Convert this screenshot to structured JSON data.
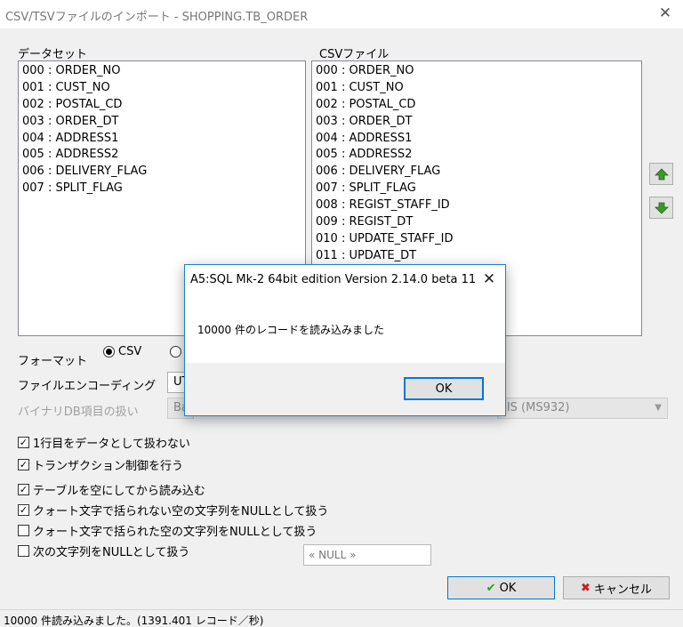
{
  "window": {
    "title": "CSV/TSVファイルのインポート - SHOPPING.TB_ORDER",
    "close_glyph": "✕"
  },
  "dataset": {
    "label": "データセット",
    "items": [
      "000 : ORDER_NO",
      "001 : CUST_NO",
      "002 : POSTAL_CD",
      "003 : ORDER_DT",
      "004 : ADDRESS1",
      "005 : ADDRESS2",
      "006 : DELIVERY_FLAG",
      "007 : SPLIT_FLAG"
    ]
  },
  "csvfile": {
    "label": "CSVファイル",
    "items": [
      "000 : ORDER_NO",
      "001 : CUST_NO",
      "002 : POSTAL_CD",
      "003 : ORDER_DT",
      "004 : ADDRESS1",
      "005 : ADDRESS2",
      "006 : DELIVERY_FLAG",
      "007 : SPLIT_FLAG",
      "008 : REGIST_STAFF_ID",
      "009 : REGIST_DT",
      "010 : UPDATE_STAFF_ID",
      "011 : UPDATE_DT"
    ]
  },
  "format": {
    "label": "フォーマット",
    "csv_label": "CSV"
  },
  "encoding": {
    "label": "ファイルエンコーディング",
    "value": "UT"
  },
  "binary": {
    "label": "バイナリDB項目の扱い",
    "value": "Ba",
    "charset_value": "JIS (MS932)"
  },
  "options": [
    {
      "label": "1行目をデータとして扱わない",
      "checked": true
    },
    {
      "label": "トランザクション制御を行う",
      "checked": true
    },
    {
      "label": "テーブルを空にしてから読み込む",
      "checked": true
    },
    {
      "label": "クォート文字で括られない空の文字列をNULLとして扱う",
      "checked": true
    },
    {
      "label": "クォート文字で括られた空の文字列をNULLとして扱う",
      "checked": false
    },
    {
      "label": "次の文字列をNULLとして扱う",
      "checked": false
    }
  ],
  "null_string": {
    "value": "« NULL »"
  },
  "buttons": {
    "ok_label": "OK",
    "cancel_label": "キャンセル"
  },
  "status": {
    "text": "10000 件読み込みました。(1391.401 レコード／秒)"
  },
  "message_box": {
    "title": "A5:SQL Mk-2 64bit edition Version 2.14.0 beta 11",
    "text": "10000 件のレコードを読み込みました",
    "ok_label": "OK",
    "close_glyph": "✕"
  },
  "colors": {
    "accent": "#0078d7",
    "arrow_green": "#3a9a2a",
    "cancel_red": "#d11a1a",
    "ok_check_green": "#2e9a2e"
  }
}
